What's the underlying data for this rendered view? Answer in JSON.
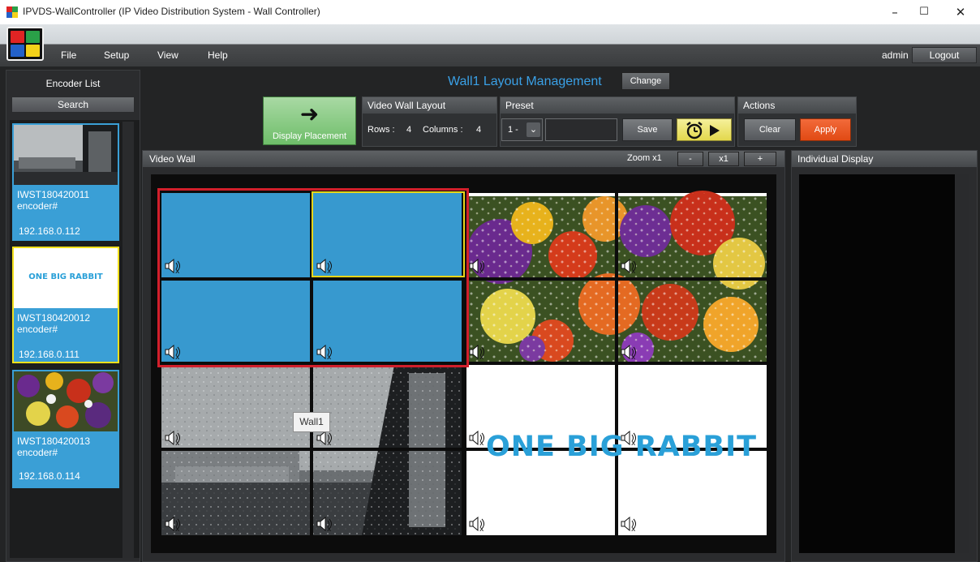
{
  "window": {
    "title": "IPVDS-WallController (IP Video Distribution System - Wall Controller)",
    "minimize": "–",
    "maximize": "☐",
    "close": "✕"
  },
  "menu": {
    "file": "File",
    "setup": "Setup",
    "view": "View",
    "help": "Help"
  },
  "user": {
    "name": "admin",
    "logout": "Logout"
  },
  "encoder_list": {
    "title": "Encoder List",
    "search": "Search",
    "items": [
      {
        "name": "IWST180420011",
        "type": "encoder#",
        "ip": "192.168.0.112",
        "thumb": "rain-window"
      },
      {
        "name": "IWST180420012",
        "type": "encoder#",
        "ip": "192.168.0.111",
        "thumb": "one-big-rabbit",
        "thumb_text": "ONE BIG RABBIT"
      },
      {
        "name": "IWST180420013",
        "type": "encoder#",
        "ip": "192.168.0.114",
        "thumb": "flowers"
      }
    ]
  },
  "header": {
    "wall_title": "Wall1 Layout Management",
    "change": "Change",
    "display_placement": "Display Placement",
    "layout_group": {
      "title": "Video Wall Layout",
      "rows_label": "Rows :",
      "rows": "4",
      "cols_label": "Columns :",
      "cols": "4"
    },
    "preset_group": {
      "title": "Preset",
      "value": "1 -",
      "save": "Save"
    },
    "actions_group": {
      "title": "Actions",
      "clear": "Clear",
      "apply": "Apply"
    }
  },
  "video_wall": {
    "title": "Video Wall",
    "zoom_label": "Zoom x1",
    "zoom_minus": "-",
    "zoom_value": "x1",
    "zoom_plus": "+",
    "tooltip": "Wall1",
    "rabbit_text": "ONE BIG RABBIT",
    "rows": 4,
    "cols": 4
  },
  "individual_display": {
    "title": "Individual Display"
  },
  "colors": {
    "accent": "#3aa0e6",
    "cell_blue": "#3799cf",
    "selection_red": "#d21f2b",
    "selection_yellow": "#e8d51a",
    "apply_orange": "#e14a14",
    "placement_green": "#6fbe6a"
  }
}
